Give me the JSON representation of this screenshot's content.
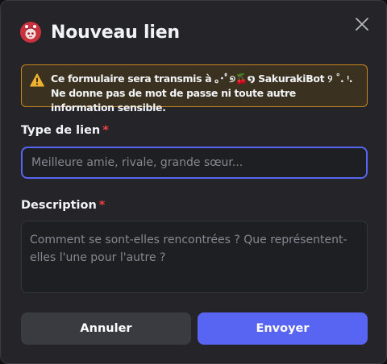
{
  "header": {
    "title": "Nouveau lien",
    "avatar_icon": "bot-avatar-icon",
    "close_icon": "close-icon"
  },
  "warning": {
    "icon": "warning-triangle-icon",
    "text": "Ce formulaire sera transmis à ｡･ﾟ୭🍒໑ SakurakiBot ୨ ˚. ᵎ. Ne donne pas de mot de passe ni toute autre information sensible."
  },
  "form": {
    "link_type": {
      "label": "Type de lien",
      "required_mark": "*",
      "value": "",
      "placeholder": "Meilleure amie, rivale, grande sœur..."
    },
    "description": {
      "label": "Description",
      "required_mark": "*",
      "value": "",
      "placeholder": "Comment se sont-elles rencontrées ? Que représentent-elles l'une pour l'autre ?"
    }
  },
  "buttons": {
    "cancel_label": "Annuler",
    "submit_label": "Envoyer"
  },
  "colors": {
    "background": "#242429",
    "accent": "#5865f2",
    "warning_border": "#c9871f",
    "warning_icon": "#f0b132",
    "required": "#f23f43"
  }
}
